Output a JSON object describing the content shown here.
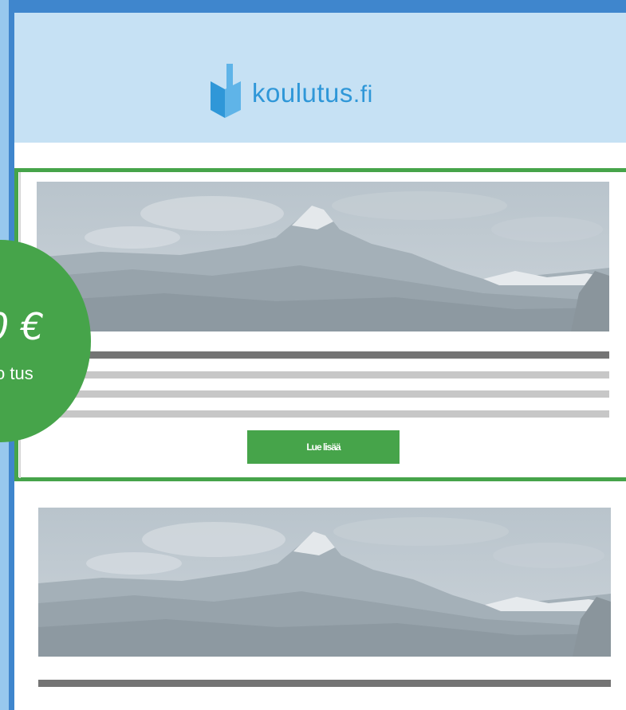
{
  "brand": {
    "name": "koulutus",
    "tld": ".fi",
    "logo_icon": "book-logo-icon",
    "color": "#2f97d8"
  },
  "colors": {
    "frame": "#3f86cd",
    "header_bg": "#c6e1f4",
    "accent_green": "#46a44a",
    "title_bar": "#747474",
    "text_line": "#c7c7c7"
  },
  "badge": {
    "price": "0 €",
    "label": "o tus"
  },
  "card_1": {
    "hero_image": "mountain-landscape-image",
    "cta_label": "Lue lisää"
  },
  "card_2": {
    "hero_image": "mountain-landscape-image"
  }
}
